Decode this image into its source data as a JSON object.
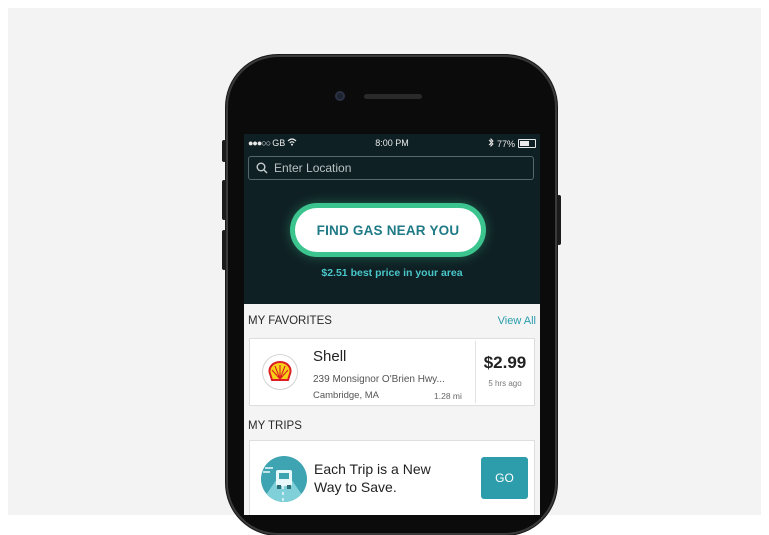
{
  "status_bar": {
    "carrier": "GB",
    "time": "8:00 PM",
    "battery": "77%",
    "battery_level": 0.77
  },
  "search": {
    "placeholder": "Enter Location"
  },
  "hero": {
    "find_button_label": "FIND GAS NEAR YOU",
    "best_price_text": "$2.51 best price in your area"
  },
  "favorites": {
    "heading": "MY FAVORITES",
    "view_all_label": "View All",
    "items": [
      {
        "name": "Shell",
        "address": "239 Monsignor O'Brien Hwy...",
        "city": "Cambridge, MA",
        "distance": "1.28 mi",
        "price": "$2.99",
        "updated": "5 hrs ago",
        "logo_icon": "shell-logo-icon"
      }
    ]
  },
  "trips": {
    "heading": "MY TRIPS",
    "card_line1": "Each Trip is a New",
    "card_line2": "Way to Save.",
    "go_label": "GO",
    "icon": "truck-road-icon"
  },
  "colors": {
    "hero_bg": "#0f2024",
    "accent_green": "#3cc48e",
    "accent_teal": "#2e9dab"
  }
}
